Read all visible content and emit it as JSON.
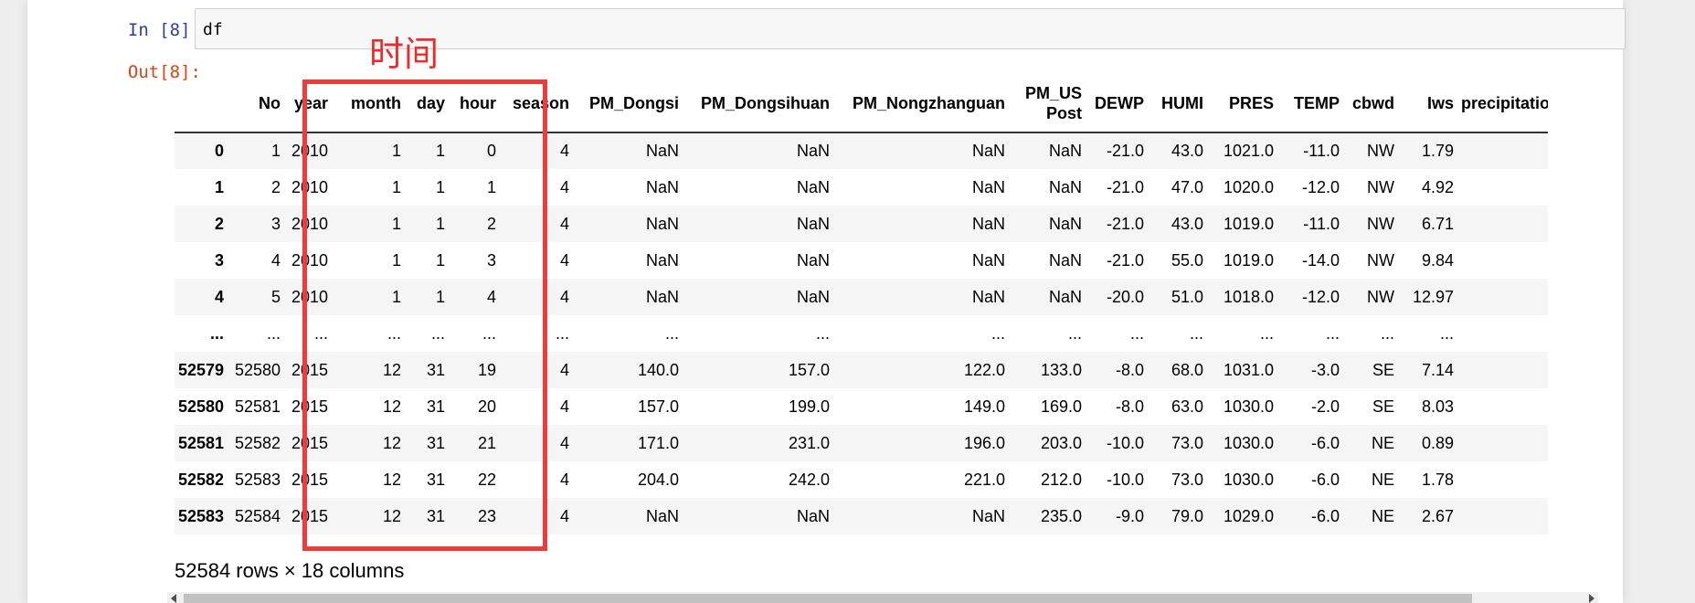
{
  "cell": {
    "in_prompt": "In  [8]:",
    "out_prompt": "Out[8]:",
    "code": "df"
  },
  "annotation": {
    "label": "时间",
    "color": "#ee3b3b"
  },
  "table": {
    "columns": [
      "",
      "No",
      "year",
      "month",
      "day",
      "hour",
      "season",
      "PM_Dongsi",
      "PM_Dongsihuan",
      "PM_Nongzhanguan",
      "PM_US Post",
      "DEWP",
      "HUMI",
      "PRES",
      "TEMP",
      "cbwd",
      "Iws",
      "precipitation"
    ],
    "rows": [
      [
        "0",
        "1",
        "2010",
        "1",
        "1",
        "0",
        "4",
        "NaN",
        "NaN",
        "NaN",
        "NaN",
        "-21.0",
        "43.0",
        "1021.0",
        "-11.0",
        "NW",
        "1.79",
        ""
      ],
      [
        "1",
        "2",
        "2010",
        "1",
        "1",
        "1",
        "4",
        "NaN",
        "NaN",
        "NaN",
        "NaN",
        "-21.0",
        "47.0",
        "1020.0",
        "-12.0",
        "NW",
        "4.92",
        ""
      ],
      [
        "2",
        "3",
        "2010",
        "1",
        "1",
        "2",
        "4",
        "NaN",
        "NaN",
        "NaN",
        "NaN",
        "-21.0",
        "43.0",
        "1019.0",
        "-11.0",
        "NW",
        "6.71",
        ""
      ],
      [
        "3",
        "4",
        "2010",
        "1",
        "1",
        "3",
        "4",
        "NaN",
        "NaN",
        "NaN",
        "NaN",
        "-21.0",
        "55.0",
        "1019.0",
        "-14.0",
        "NW",
        "9.84",
        ""
      ],
      [
        "4",
        "5",
        "2010",
        "1",
        "1",
        "4",
        "4",
        "NaN",
        "NaN",
        "NaN",
        "NaN",
        "-20.0",
        "51.0",
        "1018.0",
        "-12.0",
        "NW",
        "12.97",
        ""
      ],
      [
        "...",
        "...",
        "...",
        "...",
        "...",
        "...",
        "...",
        "...",
        "...",
        "...",
        "...",
        "...",
        "...",
        "...",
        "...",
        "...",
        "...",
        ""
      ],
      [
        "52579",
        "52580",
        "2015",
        "12",
        "31",
        "19",
        "4",
        "140.0",
        "157.0",
        "122.0",
        "133.0",
        "-8.0",
        "68.0",
        "1031.0",
        "-3.0",
        "SE",
        "7.14",
        ""
      ],
      [
        "52580",
        "52581",
        "2015",
        "12",
        "31",
        "20",
        "4",
        "157.0",
        "199.0",
        "149.0",
        "169.0",
        "-8.0",
        "63.0",
        "1030.0",
        "-2.0",
        "SE",
        "8.03",
        ""
      ],
      [
        "52581",
        "52582",
        "2015",
        "12",
        "31",
        "21",
        "4",
        "171.0",
        "231.0",
        "196.0",
        "203.0",
        "-10.0",
        "73.0",
        "1030.0",
        "-6.0",
        "NE",
        "0.89",
        ""
      ],
      [
        "52582",
        "52583",
        "2015",
        "12",
        "31",
        "22",
        "4",
        "204.0",
        "242.0",
        "221.0",
        "212.0",
        "-10.0",
        "73.0",
        "1030.0",
        "-6.0",
        "NE",
        "1.78",
        ""
      ],
      [
        "52583",
        "52584",
        "2015",
        "12",
        "31",
        "23",
        "4",
        "NaN",
        "NaN",
        "NaN",
        "235.0",
        "-9.0",
        "79.0",
        "1029.0",
        "-6.0",
        "NE",
        "2.67",
        ""
      ]
    ],
    "summary": "52584 rows × 18 columns"
  }
}
